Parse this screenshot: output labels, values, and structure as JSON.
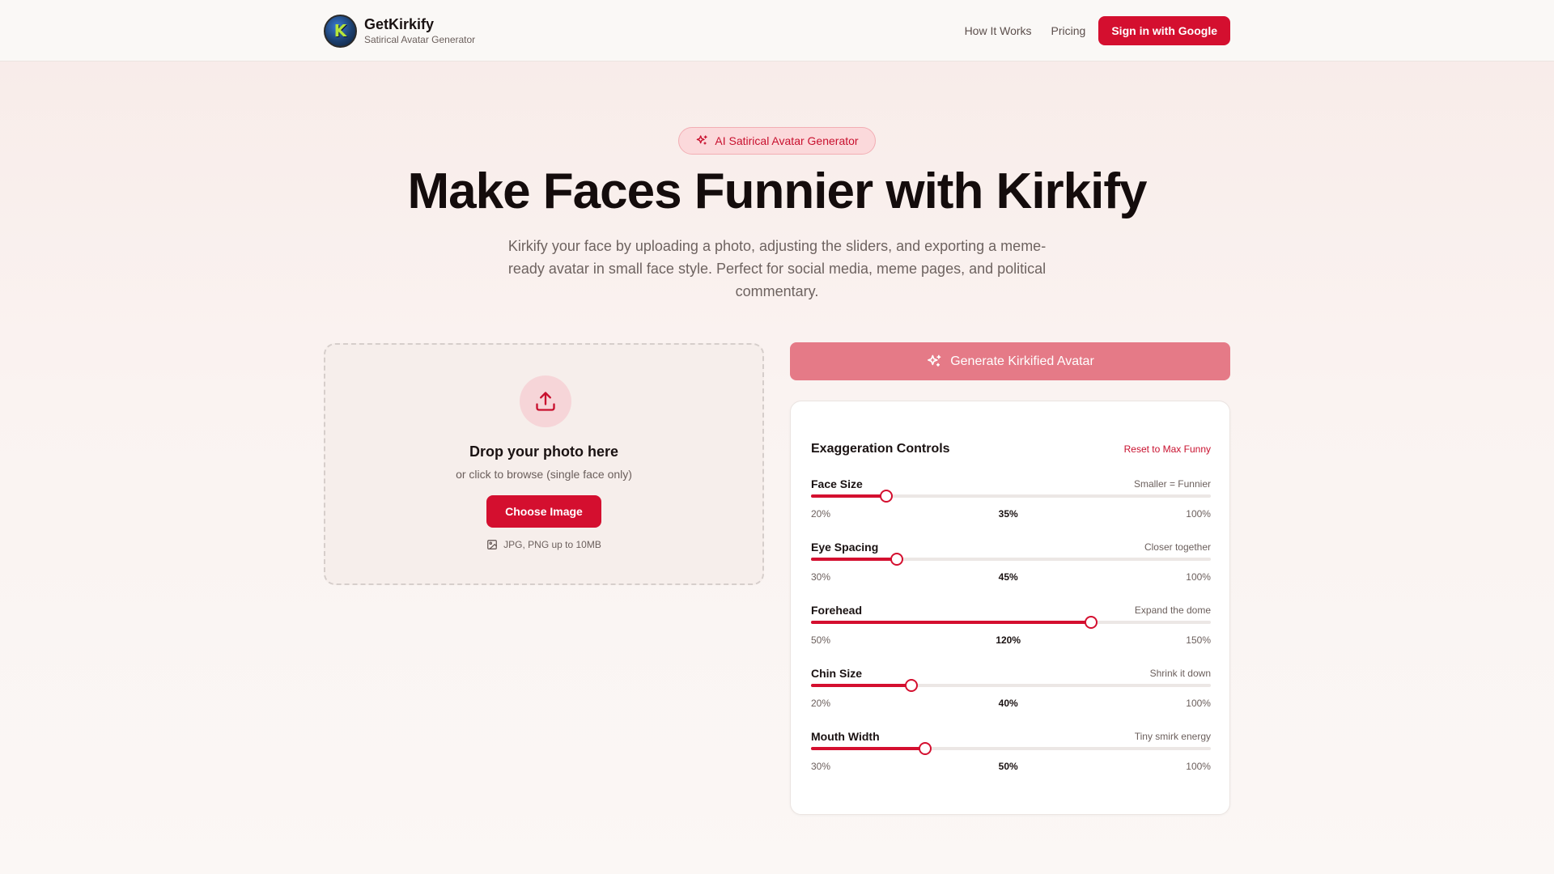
{
  "header": {
    "brand_name": "GetKirkify",
    "brand_sub": "Satirical Avatar Generator",
    "nav": [
      "How It Works",
      "Pricing"
    ],
    "signin_label": "Sign in with Google"
  },
  "hero": {
    "badge": "AI Satirical Avatar Generator",
    "title": "Make Faces Funnier with Kirkify",
    "description": "Kirkify your face by uploading a photo, adjusting the sliders, and exporting a meme-ready avatar in small face style. Perfect for social media, meme pages, and political commentary."
  },
  "upload": {
    "title": "Drop your photo here",
    "subtitle": "or click to browse (single face only)",
    "button": "Choose Image",
    "hint": "JPG, PNG up to 10MB"
  },
  "generate_label": "Generate Kirkified Avatar",
  "controls": {
    "title": "Exaggeration Controls",
    "reset": "Reset to Max Funny",
    "items": [
      {
        "label": "Face Size",
        "hint": "Smaller = Funnier",
        "min": "20%",
        "value": "35%",
        "max": "100%",
        "fraction": 0.1875
      },
      {
        "label": "Eye Spacing",
        "hint": "Closer together",
        "min": "30%",
        "value": "45%",
        "max": "100%",
        "fraction": 0.2143
      },
      {
        "label": "Forehead",
        "hint": "Expand the dome",
        "min": "50%",
        "value": "120%",
        "max": "150%",
        "fraction": 0.7
      },
      {
        "label": "Chin Size",
        "hint": "Shrink it down",
        "min": "20%",
        "value": "40%",
        "max": "100%",
        "fraction": 0.25
      },
      {
        "label": "Mouth Width",
        "hint": "Tiny smirk energy",
        "min": "30%",
        "value": "50%",
        "max": "100%",
        "fraction": 0.2857
      }
    ]
  },
  "colors": {
    "accent": "#d40f2f",
    "generate_disabled": "#e57a87",
    "badge_bg": "#fbd9db"
  }
}
